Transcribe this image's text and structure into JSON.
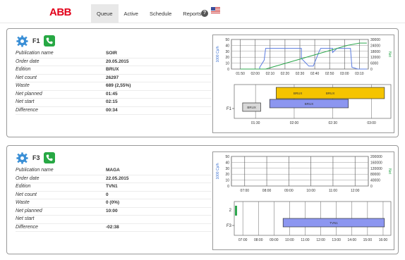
{
  "header": {
    "logo": "ABB",
    "nav": [
      "Queue",
      "Active",
      "Schedule",
      "Reports"
    ],
    "active_tab": "Queue",
    "help_label": "?"
  },
  "labels": [
    "Publication name",
    "Order date",
    "Edition",
    "Net count",
    "Waste",
    "Net planned",
    "Net start",
    "Difference"
  ],
  "panels": [
    {
      "title": "F1",
      "values": [
        "SOIR",
        "20.05.2015",
        "BRUX",
        "26297",
        "689 (2,55%)",
        "01:45",
        "02:15",
        "00:34"
      ]
    },
    {
      "title": "F3",
      "values": [
        "MAGA",
        "22.05.2015",
        "TVN1",
        "0",
        "0 (0%)",
        "10:00",
        "",
        "-02:38"
      ]
    }
  ],
  "chart_data": [
    {
      "type": "line",
      "ylabel": "1000 Cp/h",
      "y2label": "Net",
      "ylim": [
        0,
        50
      ],
      "yticks": [
        "50",
        "40",
        "30",
        "20",
        "10",
        "0"
      ],
      "y2lim": [
        0,
        30000
      ],
      "y2ticks": [
        "30000",
        "24000",
        "18000",
        "12000",
        "6000",
        "0"
      ],
      "xticks": [
        "01:50",
        "02:00",
        "02:10",
        "02:20",
        "02:30",
        "02:40",
        "02:50",
        "03:00",
        "03:10"
      ],
      "series": [
        {
          "color": "#5b7ce0",
          "x": [
            "01:50",
            "02:03",
            "02:03",
            "02:06",
            "02:07",
            "02:31",
            "02:31",
            "02:36",
            "02:39",
            "02:43",
            "02:44",
            "02:52",
            "02:52",
            "02:55",
            "02:56",
            "03:00",
            "03:02",
            "03:04",
            "03:05",
            "03:09",
            "03:15"
          ],
          "values": [
            0,
            0,
            3,
            15,
            35,
            35,
            18,
            5,
            5,
            30,
            35,
            35,
            28,
            35,
            35,
            35,
            35,
            35,
            3,
            0,
            0
          ]
        },
        {
          "color": "#2fa84f",
          "axis": "y2",
          "x": [
            "01:50",
            "02:07",
            "03:02",
            "03:10",
            "03:15"
          ],
          "values": [
            0,
            0,
            24000,
            26297,
            26297
          ]
        }
      ]
    },
    {
      "type": "gantt",
      "row_label": "F1",
      "xticks": [
        "01:30",
        "02:00",
        "02:30",
        "03:00"
      ],
      "bars": [
        {
          "labels": [
            "BRUX",
            "BRUX"
          ],
          "start": "01:46",
          "end": "03:10",
          "color": "#f5c400"
        },
        {
          "labels": [
            "BRUX"
          ],
          "start": "01:41",
          "end": "02:42",
          "color": "#8c96f0"
        },
        {
          "labels": [
            "BRUX"
          ],
          "start": "01:20",
          "end": "01:34",
          "color": "#d8d8d8"
        }
      ]
    },
    {
      "type": "line",
      "ylabel": "1000 Cp/h",
      "y2label": "Net",
      "ylim": [
        0,
        50
      ],
      "yticks": [
        "50",
        "40",
        "30",
        "20",
        "10",
        "0"
      ],
      "y2lim": [
        0,
        200000
      ],
      "y2ticks": [
        "200000",
        "160000",
        "120000",
        "80000",
        "40000",
        "0"
      ],
      "xticks": [
        "07:00",
        "08:00",
        "09:00",
        "10:00",
        "11:00",
        "12:00"
      ],
      "series": []
    },
    {
      "type": "gantt",
      "row_label": "F3",
      "secondary_label": "2",
      "xticks": [
        "07:00",
        "08:00",
        "09:00",
        "10:00",
        "11:00",
        "12:00",
        "13:00",
        "14:00",
        "15:00",
        "16:00"
      ],
      "bars": [
        {
          "labels": [
            "TVN1"
          ],
          "start": "09:35",
          "end": "16:05",
          "color": "#8c96f0"
        }
      ]
    }
  ]
}
